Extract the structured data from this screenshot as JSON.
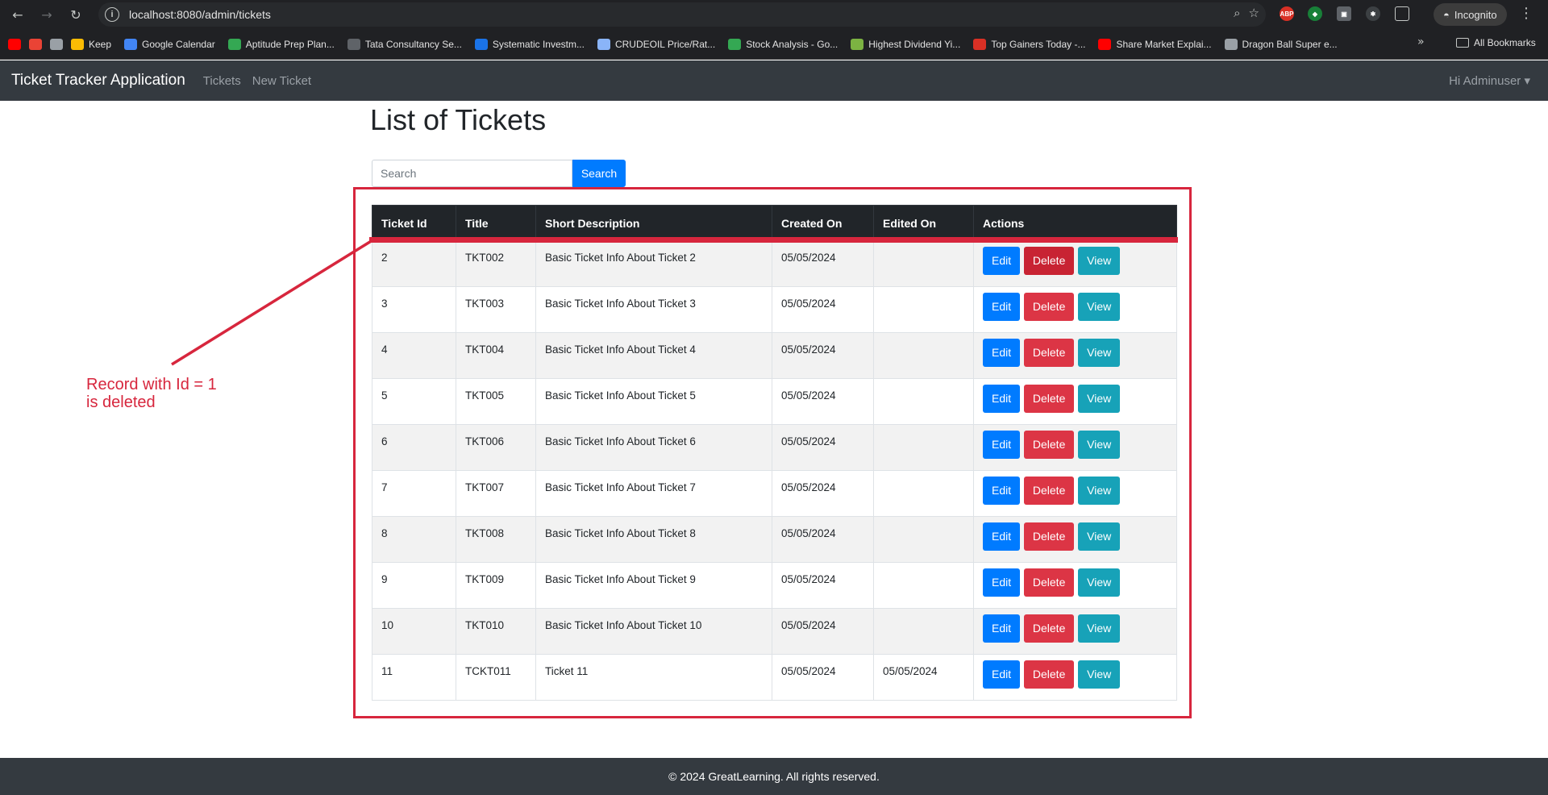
{
  "browser": {
    "url": "localhost:8080/admin/tickets",
    "profile_label": "Incognito",
    "bookmarks": [
      {
        "label": "",
        "icon": "youtube-icon",
        "color": "#ff0000"
      },
      {
        "label": "",
        "icon": "gmail-icon",
        "color": "#ea4335"
      },
      {
        "label": "",
        "icon": "store-icon",
        "color": "#9aa0a6"
      },
      {
        "label": "Keep",
        "icon": "keep-icon",
        "color": "#fbbc04"
      },
      {
        "label": "Google Calendar",
        "icon": "calendar-icon",
        "color": "#4285f4"
      },
      {
        "label": "Aptitude Prep Plan...",
        "icon": "aptitude-icon",
        "color": "#34a853"
      },
      {
        "label": "Tata Consultancy Se...",
        "icon": "tcs-icon",
        "color": "#5f6368"
      },
      {
        "label": "Systematic Investm...",
        "icon": "sip-icon",
        "color": "#1a73e8"
      },
      {
        "label": "CRUDEOIL Price/Rat...",
        "icon": "crudeoil-icon",
        "color": "#8ab4f8"
      },
      {
        "label": "Stock Analysis - Go...",
        "icon": "sheets-icon",
        "color": "#34a853"
      },
      {
        "label": "Highest Dividend Yi...",
        "icon": "bar-chart-icon",
        "color": "#7cb342"
      },
      {
        "label": "Top Gainers Today -...",
        "icon": "et-icon",
        "color": "#d93025"
      },
      {
        "label": "Share Market Explai...",
        "icon": "youtube-icon",
        "color": "#ff0000"
      },
      {
        "label": "Dragon Ball Super e...",
        "icon": "globe-icon",
        "color": "#9aa0a6"
      }
    ],
    "all_bookmarks_label": "All Bookmarks"
  },
  "navbar": {
    "brand": "Ticket Tracker Application",
    "links": [
      "Tickets",
      "New Ticket"
    ],
    "user": "Hi Adminuser"
  },
  "page": {
    "title": "List of Tickets",
    "search_placeholder": "Search",
    "search_button": "Search"
  },
  "table": {
    "headers": [
      "Ticket Id",
      "Title",
      "Short Description",
      "Created On",
      "Edited On",
      "Actions"
    ],
    "rows": [
      {
        "id": "2",
        "title": "TKT002",
        "desc": "Basic Ticket Info About Ticket 2",
        "created": "05/05/2024",
        "edited": ""
      },
      {
        "id": "3",
        "title": "TKT003",
        "desc": "Basic Ticket Info About Ticket 3",
        "created": "05/05/2024",
        "edited": ""
      },
      {
        "id": "4",
        "title": "TKT004",
        "desc": "Basic Ticket Info About Ticket 4",
        "created": "05/05/2024",
        "edited": ""
      },
      {
        "id": "5",
        "title": "TKT005",
        "desc": "Basic Ticket Info About Ticket 5",
        "created": "05/05/2024",
        "edited": ""
      },
      {
        "id": "6",
        "title": "TKT006",
        "desc": "Basic Ticket Info About Ticket 6",
        "created": "05/05/2024",
        "edited": ""
      },
      {
        "id": "7",
        "title": "TKT007",
        "desc": "Basic Ticket Info About Ticket 7",
        "created": "05/05/2024",
        "edited": ""
      },
      {
        "id": "8",
        "title": "TKT008",
        "desc": "Basic Ticket Info About Ticket 8",
        "created": "05/05/2024",
        "edited": ""
      },
      {
        "id": "9",
        "title": "TKT009",
        "desc": "Basic Ticket Info About Ticket 9",
        "created": "05/05/2024",
        "edited": ""
      },
      {
        "id": "10",
        "title": "TKT010",
        "desc": "Basic Ticket Info About Ticket 10",
        "created": "05/05/2024",
        "edited": ""
      },
      {
        "id": "11",
        "title": "TCKT011",
        "desc": "Ticket 11",
        "created": "05/05/2024",
        "edited": "05/05/2024"
      }
    ],
    "action_labels": {
      "edit": "Edit",
      "delete": "Delete",
      "view": "View"
    }
  },
  "annotation": {
    "line1": "Record with Id = 1",
    "line2": "is deleted",
    "color": "#d7263d"
  },
  "footer": {
    "text": "© 2024 GreatLearning. All rights reserved."
  },
  "colors": {
    "primary": "#007bff",
    "danger": "#dc3545",
    "info": "#17a2b8",
    "navbar": "#343a40",
    "table_header": "#212529"
  }
}
